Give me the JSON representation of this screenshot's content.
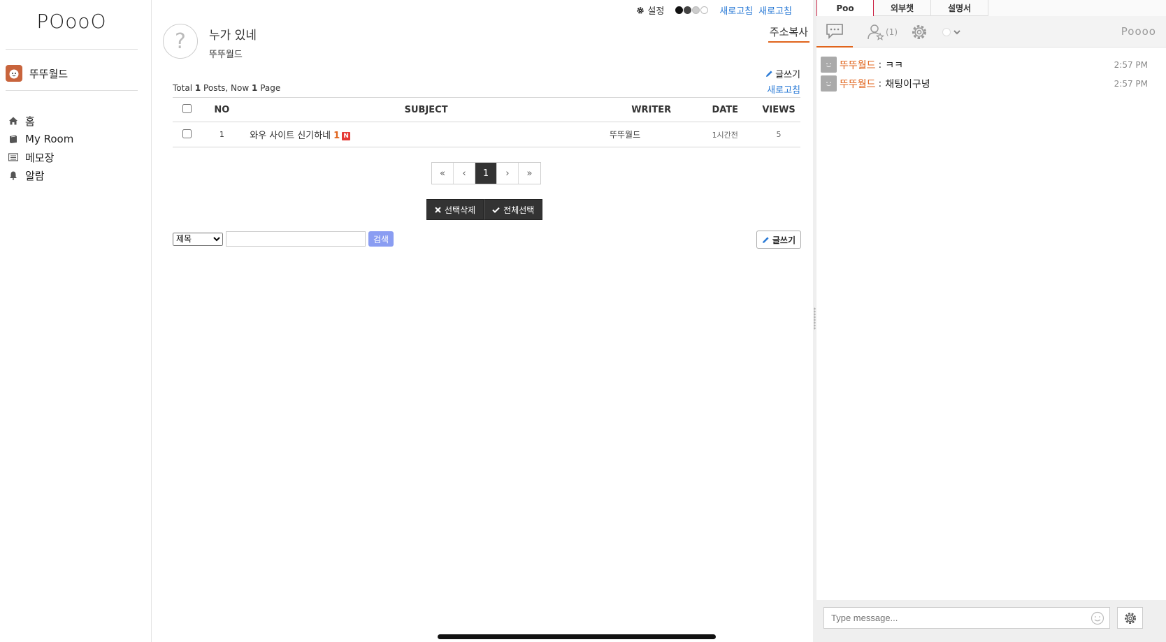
{
  "sidebar": {
    "logo": "POooO",
    "user_name": "뚜뚜월드",
    "nav": [
      {
        "label": "홈",
        "icon": "home-icon"
      },
      {
        "label": "My Room",
        "icon": "book-icon"
      },
      {
        "label": "메모장",
        "icon": "memo-icon"
      },
      {
        "label": "알람",
        "icon": "bell-icon"
      }
    ]
  },
  "topbar": {
    "settings_label": "설정",
    "refresh1": "새로고침",
    "refresh2": "새로고침"
  },
  "board": {
    "title": "누가 있네",
    "subtitle": "뚜뚜월드",
    "avatar_placeholder": "?",
    "address_copy": "주소복사",
    "write_label": "글쓰기",
    "refresh_label": "새로고침",
    "total_prefix": "Total",
    "total_posts": "1",
    "total_mid": "Posts, Now",
    "current_page": "1",
    "total_suffix": "Page",
    "columns": {
      "no": "NO",
      "subject": "SUBJECT",
      "writer": "WRITER",
      "date": "DATE",
      "views": "VIEWS"
    },
    "rows": [
      {
        "no": "1",
        "subject": "와우 사이트 신기하네",
        "comment_count": "1",
        "new_badge": "N",
        "writer": "뚜뚜월드",
        "date": "1시간전",
        "views": "5"
      }
    ],
    "pagination": {
      "first": "«",
      "prev": "‹",
      "page": "1",
      "next": "›",
      "last": "»"
    },
    "delete_selected": "선택삭제",
    "select_all": "전체선택",
    "search_option": "제목",
    "search_button": "검색",
    "write_button": "글쓰기"
  },
  "chat": {
    "tabs": [
      "Poo",
      "외부챗",
      "설명서"
    ],
    "user_count": "(1)",
    "room_name": "Poooo",
    "messages": [
      {
        "nick": "뚜뚜월드",
        "text": "ㅋㅋ",
        "time": "2:57 PM"
      },
      {
        "nick": "뚜뚜월드",
        "text": "채팅이구녕",
        "time": "2:57 PM"
      }
    ],
    "input_placeholder": "Type message..."
  },
  "colors": {
    "accent": "#e0641c",
    "link": "#2a7ad6",
    "dark_button": "#333333",
    "search_button": "#8a9df2"
  }
}
